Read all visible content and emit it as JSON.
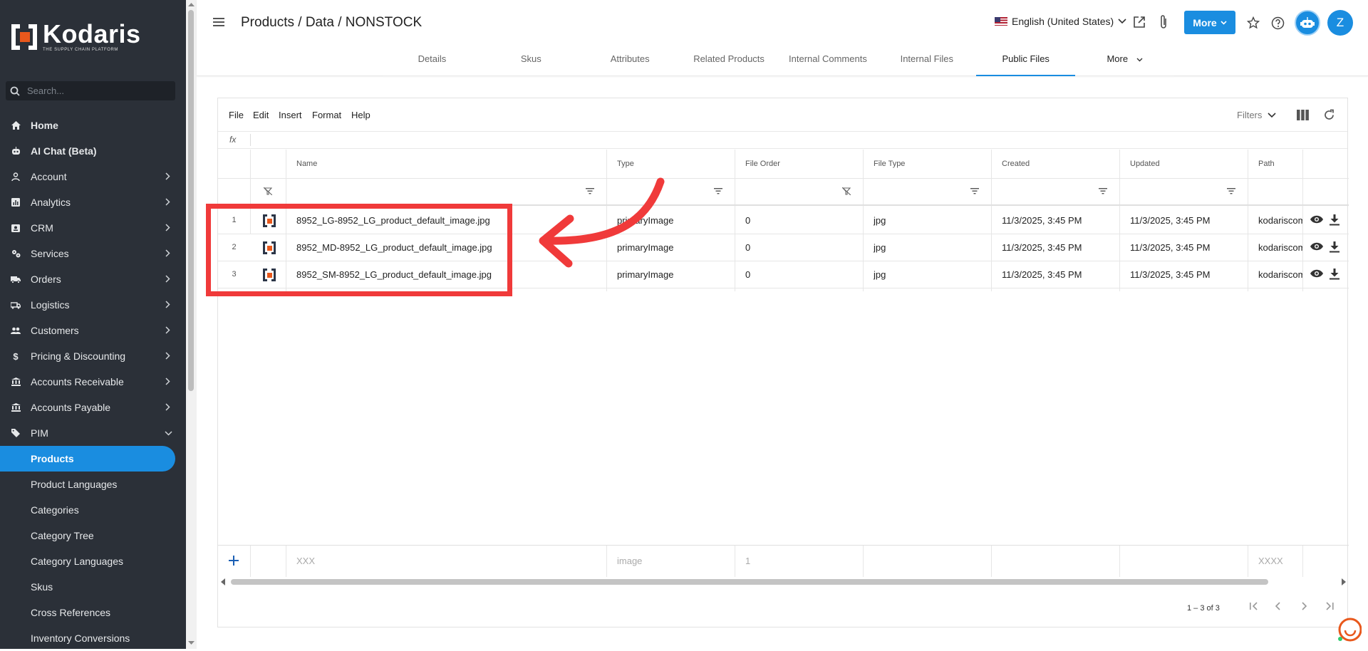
{
  "sidebar": {
    "brand": "Kodaris",
    "tagline": "THE SUPPLY CHAIN PLATFORM",
    "search_placeholder": "Search...",
    "items": [
      {
        "label": "Home",
        "icon": "home-icon"
      },
      {
        "label": "AI Chat (Beta)",
        "icon": "robot-icon"
      },
      {
        "label": "Account",
        "icon": "user-icon"
      },
      {
        "label": "Analytics",
        "icon": "analytics-icon"
      },
      {
        "label": "CRM",
        "icon": "crm-icon"
      },
      {
        "label": "Services",
        "icon": "services-icon"
      },
      {
        "label": "Orders",
        "icon": "truck-icon"
      },
      {
        "label": "Logistics",
        "icon": "logistics-icon"
      },
      {
        "label": "Customers",
        "icon": "customers-icon"
      },
      {
        "label": "Pricing & Discounting",
        "icon": "dollar-icon"
      },
      {
        "label": "Accounts Receivable",
        "icon": "bank-icon"
      },
      {
        "label": "Accounts Payable",
        "icon": "bank-icon"
      },
      {
        "label": "PIM",
        "icon": "tag-icon"
      }
    ],
    "sub_items": [
      "Products",
      "Product Languages",
      "Categories",
      "Category Tree",
      "Category Languages",
      "Skus",
      "Cross References",
      "Inventory Conversions"
    ]
  },
  "header": {
    "breadcrumb": "Products / Data / NONSTOCK",
    "language": "English (United States)",
    "more_label": "More",
    "avatar_initial": "Z"
  },
  "tabs": [
    "Details",
    "Skus",
    "Attributes",
    "Related Products",
    "Internal Comments",
    "Internal Files",
    "Public Files",
    "More"
  ],
  "active_tab": "Public Files",
  "menubar": [
    "File",
    "Edit",
    "Insert",
    "Format",
    "Help"
  ],
  "filters_label": "Filters",
  "fx_label": "fx",
  "columns": [
    "Name",
    "Type",
    "File Order",
    "File Type",
    "Created",
    "Updated",
    "Path"
  ],
  "rows": [
    {
      "num": "1",
      "name": "8952_LG-8952_LG_product_default_image.jpg",
      "type": "primaryImage",
      "order": "0",
      "filetype": "jpg",
      "created": "11/3/2025, 3:45 PM",
      "updated": "11/3/2025, 3:45 PM",
      "path": "kodariscom"
    },
    {
      "num": "2",
      "name": "8952_MD-8952_LG_product_default_image.jpg",
      "type": "primaryImage",
      "order": "0",
      "filetype": "jpg",
      "created": "11/3/2025, 3:45 PM",
      "updated": "11/3/2025, 3:45 PM",
      "path": "kodariscom"
    },
    {
      "num": "3",
      "name": "8952_SM-8952_LG_product_default_image.jpg",
      "type": "primaryImage",
      "order": "0",
      "filetype": "jpg",
      "created": "11/3/2025, 3:45 PM",
      "updated": "11/3/2025, 3:45 PM",
      "path": "kodariscom"
    }
  ],
  "new_row": {
    "name": "XXX",
    "type": "image",
    "order": "1",
    "path": "XXXX"
  },
  "pager": {
    "label": "1 – 3 of 3"
  },
  "colors": {
    "accent": "#1a8de0",
    "sidebar": "#2b3038",
    "annotation": "#f03a3a",
    "brand_orange": "#e8581c"
  }
}
